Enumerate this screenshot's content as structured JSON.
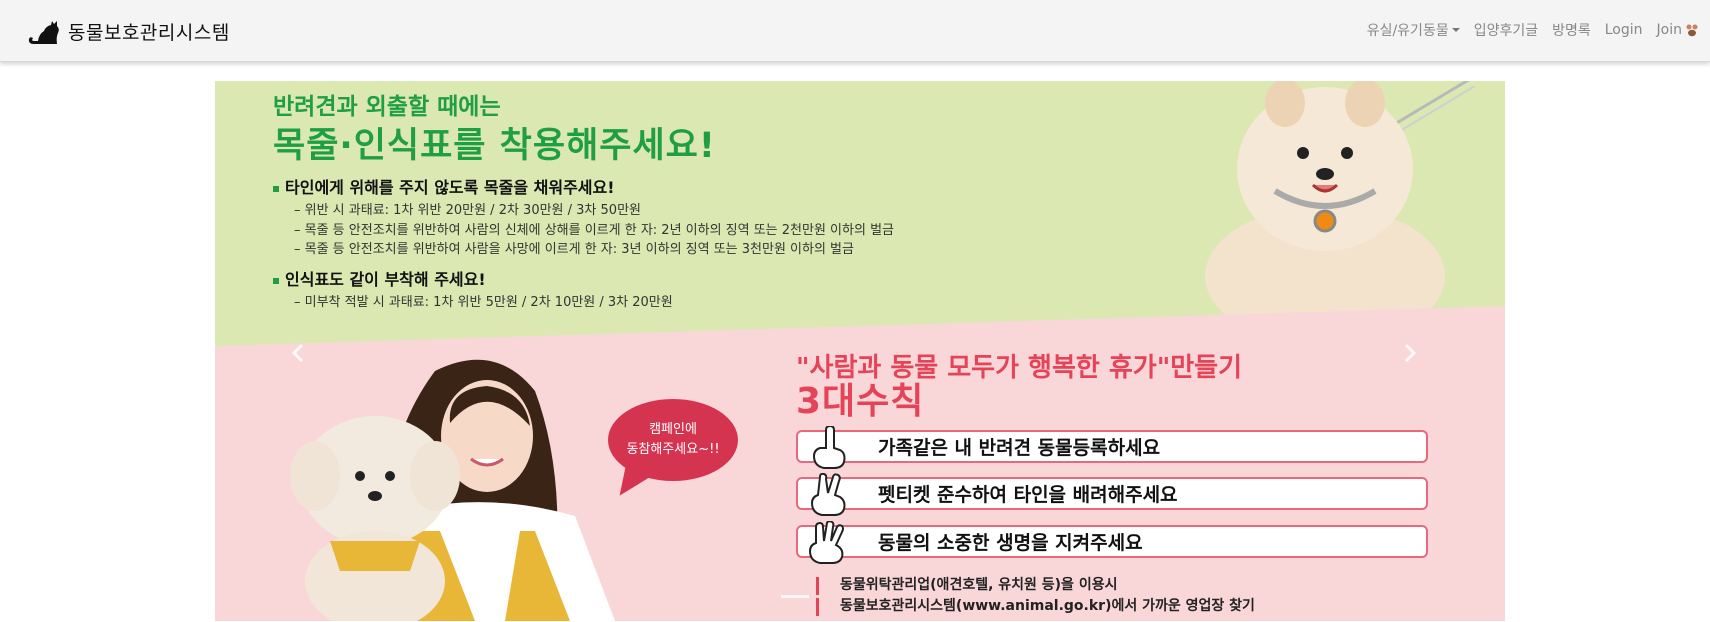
{
  "header": {
    "brand_title": "동물보호관리시스템",
    "nav": [
      {
        "label": "유실/유기동물",
        "dropdown": true
      },
      {
        "label": "입양후기글"
      },
      {
        "label": "방명록"
      },
      {
        "label": "Login"
      },
      {
        "label": "Join"
      }
    ]
  },
  "banner": {
    "green": {
      "heading1": "반려견과 외출할 때에는",
      "heading2": "목줄·인식표를 착용해주세요!",
      "bullet1": "타인에게 위해를 주지 않도록 목줄을 채워주세요!",
      "lines1": [
        "– 위반 시 과태료: 1차 위반 20만원 / 2차 30만원 / 3차 50만원",
        "– 목줄 등 안전조치를 위반하여 사람의 신체에 상해를 이르게 한 자: 2년 이하의 징역 또는 2천만원 이하의 벌금",
        "– 목줄 등 안전조치를 위반하여 사람을 사망에 이르게 한 자: 3년 이하의 징역 또는 3천만원 이하의 벌금"
      ],
      "bullet2": "인식표도 같이 부착해 주세요!",
      "lines2": [
        "– 미부착 적발 시 과태료: 1차 위반 5만원 / 2차 10만원 / 3차 20만원"
      ]
    },
    "pink": {
      "quote": "\"사람과 동물 모두가 행복한 휴가\"만들기",
      "rules_title": "3대수칙",
      "rules": [
        "가족같은 내 반려견 동물등록하세요",
        "펫티켓 준수하여 타인을 배려해주세요",
        "동물의 소중한 생명을 지켜주세요"
      ],
      "info": [
        "동물위탁관리업(애견호텔, 유치원 등)을 이용시",
        "동물보호관리시스템(www.animal.go.kr)에서 가까운 영업장 찾기"
      ],
      "bubble": [
        "캠페인에",
        "동참해주세요~!!"
      ]
    }
  },
  "colors": {
    "green_bg": "#dbe8b2",
    "green_text": "#1f9e44",
    "pink_bg": "#f9d7d9",
    "pink_text": "#e54358"
  }
}
